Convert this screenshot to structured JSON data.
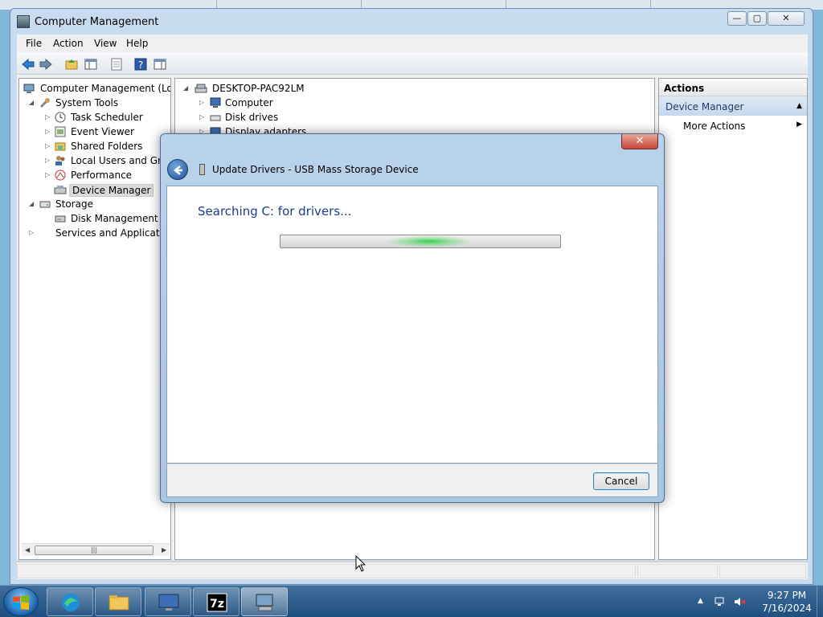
{
  "window": {
    "title": "Computer Management",
    "controls": {
      "minimize": "—",
      "maximize": "▢",
      "close": "✕"
    }
  },
  "menu": [
    "File",
    "Action",
    "View",
    "Help"
  ],
  "tree": {
    "root": "Computer Management (Local",
    "system_tools": "System Tools",
    "task_scheduler": "Task Scheduler",
    "event_viewer": "Event Viewer",
    "shared_folders": "Shared Folders",
    "local_users": "Local Users and Group",
    "performance": "Performance",
    "device_manager": "Device Manager",
    "storage": "Storage",
    "disk_management": "Disk Management",
    "services_apps": "Services and Applications"
  },
  "devices": {
    "root": "DESKTOP-PAC92LM",
    "items": [
      "Computer",
      "Disk drives",
      "Display adapters"
    ]
  },
  "actions": {
    "header": "Actions",
    "section": "Device Manager",
    "more": "More Actions"
  },
  "dialog": {
    "title": "Update Drivers - USB Mass Storage Device",
    "message": "Searching C: for drivers...",
    "cancel": "Cancel",
    "close": "✕"
  },
  "taskbar": {
    "time": "9:27 PM",
    "date": "7/16/2024",
    "apps": [
      "edge-icon",
      "folder-icon",
      "monitor-icon",
      "7zip-icon",
      "computer-management-icon"
    ],
    "sevenzip_label": "7z"
  },
  "colors": {
    "dialog_message": "#1e3a8a",
    "progress_glow": "#34d24a",
    "taskbar": "#1f4f7e"
  }
}
